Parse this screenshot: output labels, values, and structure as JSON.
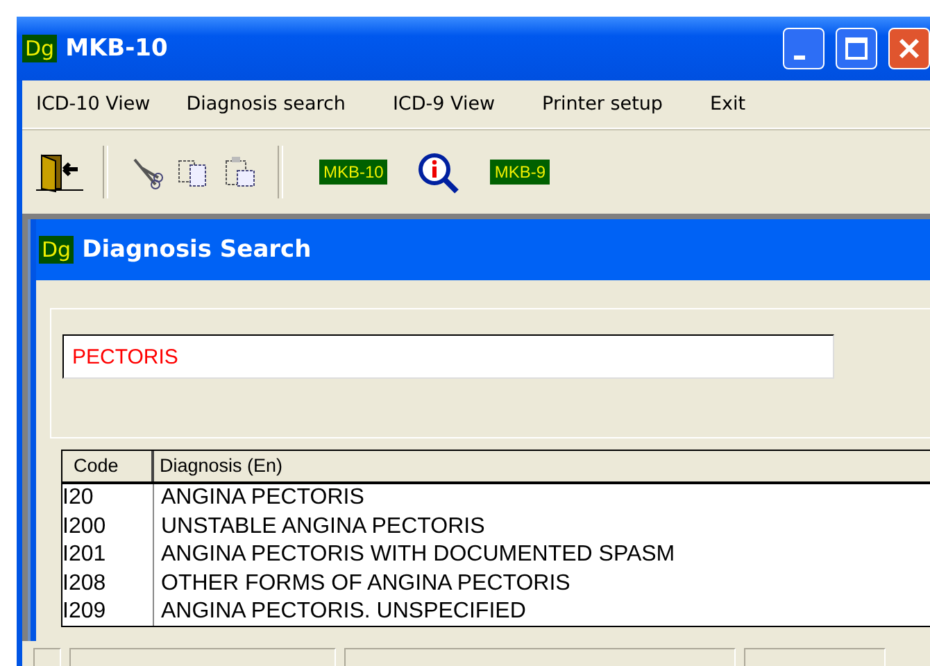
{
  "window": {
    "icon": "Dg",
    "title": "MKB-10"
  },
  "menu": [
    "ICD-10 View",
    "Diagnosis search",
    "ICD-9 View",
    "Printer setup",
    "Exit"
  ],
  "toolbar": [
    {
      "kind": "exit"
    },
    {
      "kind": "separator"
    },
    {
      "kind": "cut"
    },
    {
      "kind": "copy"
    },
    {
      "kind": "paste"
    },
    {
      "kind": "separator"
    },
    {
      "kind": "badge",
      "label": "MKB-10"
    },
    {
      "kind": "info"
    },
    {
      "kind": "badge",
      "label": "MKB-9"
    }
  ],
  "child_window": {
    "icon": "Dg",
    "title": "Diagnosis Search"
  },
  "search": {
    "value": "PECTORIS"
  },
  "table": {
    "columns": [
      "Code",
      "Diagnosis (En)"
    ],
    "rows": [
      [
        "I20",
        "ANGINA PECTORIS"
      ],
      [
        "I200",
        "UNSTABLE ANGINA PECTORIS"
      ],
      [
        "I201",
        "ANGINA PECTORIS WITH DOCUMENTED SPASM"
      ],
      [
        "I208",
        "OTHER FORMS OF ANGINA PECTORIS"
      ],
      [
        "I209",
        "ANGINA PECTORIS. UNSPECIFIED"
      ]
    ]
  }
}
